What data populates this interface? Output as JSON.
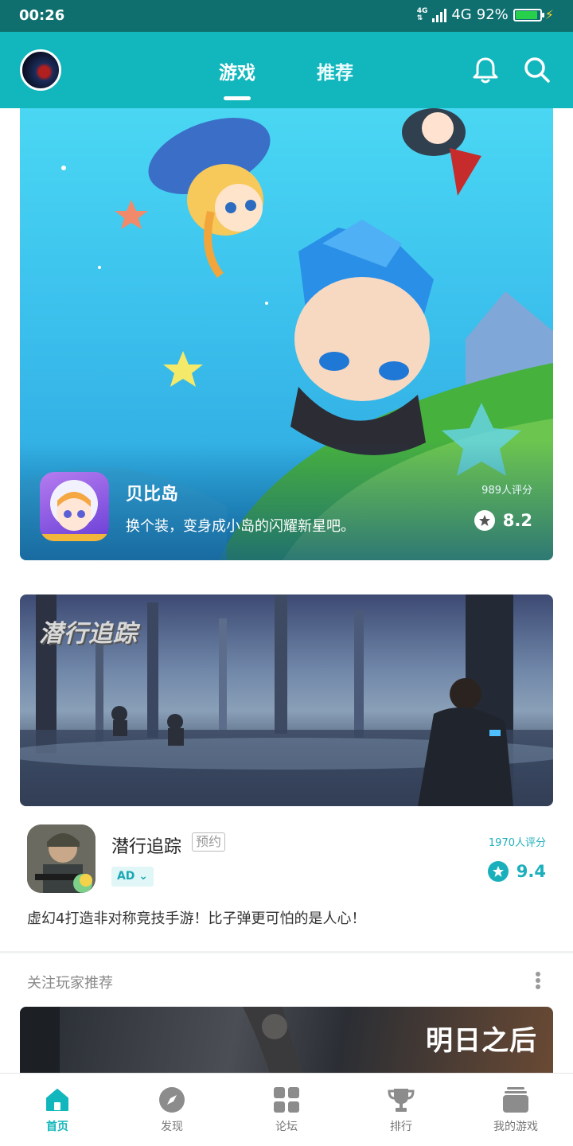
{
  "status_bar": {
    "time": "00:26",
    "network_tag": "4G",
    "network": "4G",
    "battery": "92%",
    "battery_level": 0.92
  },
  "header": {
    "tabs": [
      {
        "label": "游戏",
        "active": true
      },
      {
        "label": "推荐",
        "active": false
      }
    ]
  },
  "hero_card": {
    "name": "贝比岛",
    "description": "换个装，变身成小岛的闪耀新星吧。",
    "rating_count": "989人评分",
    "score": "8.2"
  },
  "game_card": {
    "banner_title": "潜行追踪",
    "name": "潜行追踪",
    "tag": "预约",
    "ad_label": "AD",
    "rating_count": "1970人评分",
    "score": "9.4",
    "description": "虚幻4打造非对称竞技手游！比子弹更可怕的是人心！"
  },
  "section": {
    "title": "关注玩家推荐",
    "banner_title": "明日之后"
  },
  "bottom_nav": [
    {
      "label": "首页",
      "icon": "home-icon",
      "active": true
    },
    {
      "label": "发现",
      "icon": "compass-icon",
      "active": false
    },
    {
      "label": "论坛",
      "icon": "grid-icon",
      "active": false
    },
    {
      "label": "排行",
      "icon": "trophy-icon",
      "active": false
    },
    {
      "label": "我的游戏",
      "icon": "game-library-icon",
      "active": false
    }
  ],
  "colors": {
    "primary": "#12b7bd",
    "status_bar": "#0f6f6f",
    "battery": "#27d04a"
  }
}
